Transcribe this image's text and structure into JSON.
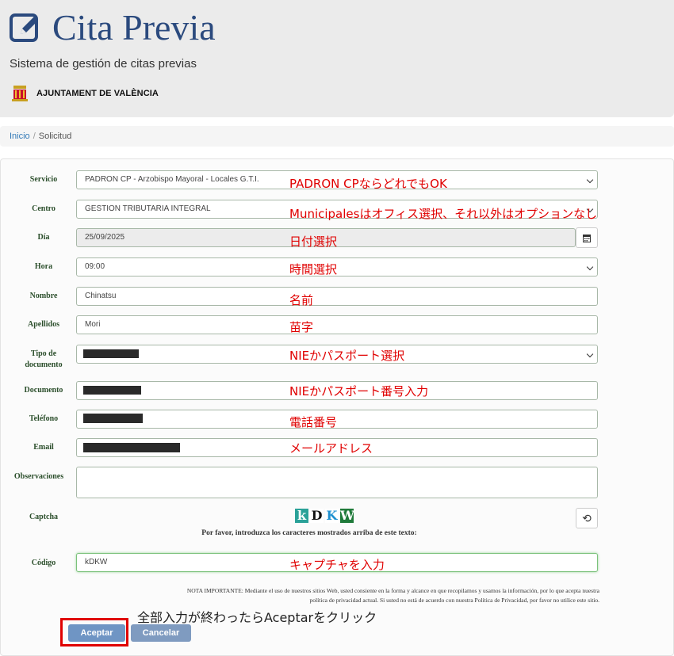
{
  "header": {
    "title": "Cita Previa",
    "subtitle": "Sistema de gestión de citas previas",
    "org_name": "AJUNTAMENT DE VALÈNCIA"
  },
  "breadcrumb": {
    "home": "Inicio",
    "separator": "/",
    "current": "Solicitud"
  },
  "form": {
    "servicio": {
      "label": "Servicio",
      "value": "PADRON CP - Arzobispo Mayoral - Locales G.T.I."
    },
    "centro": {
      "label": "Centro",
      "value": "GESTION TRIBUTARIA INTEGRAL"
    },
    "dia": {
      "label": "Día",
      "value": "25/09/2025"
    },
    "hora": {
      "label": "Hora",
      "value": "09:00"
    },
    "nombre": {
      "label": "Nombre",
      "value": "Chinatsu"
    },
    "apellidos": {
      "label": "Apellidos",
      "value": "Mori"
    },
    "tipo_documento": {
      "label_line1": "Tipo de",
      "label_line2": "documento"
    },
    "documento": {
      "label": "Documento"
    },
    "telefono": {
      "label": "Teléfono"
    },
    "email": {
      "label": "Email"
    },
    "observaciones": {
      "label": "Observaciones",
      "value": ""
    },
    "captcha": {
      "label": "Captcha",
      "chars": [
        "k",
        "D",
        "K",
        "W"
      ],
      "help": "Por favor, introduzca los caracteres mostrados arriba de este texto:",
      "refresh_icon": "⟲"
    },
    "codigo": {
      "label": "Código",
      "value": "kDKW"
    }
  },
  "legal_note": "NOTA IMPORTANTE: Mediante el uso de nuestros sitios Web, usted consiente en la forma y alcance en que recopilamos y usamos la información, por lo que acepta nuestra política de privacidad actual. Si usted no está de acuerdo con nuestra Política de Privacidad, por favor no utilice este sitio.",
  "buttons": {
    "accept": "Aceptar",
    "cancel": "Cancelar"
  },
  "annotations": {
    "servicio": "PADRON CPならどれでもOK",
    "centro": "Municipalesはオフィス選択、それ以外はオプションなし",
    "dia": "日付選択",
    "hora": "時間選択",
    "nombre": "名前",
    "apellidos": "苗字",
    "tipo_documento": "NIEかパスポート選択",
    "documento": "NIEかパスポート番号入力",
    "telefono": "電話番号",
    "email": "メールアドレス",
    "codigo": "キャプチャを入力",
    "submit": "全部入力が終わったらAceptarをクリック"
  },
  "colors": {
    "title": "#2b4a7e",
    "annotation_red": "#e00000",
    "label_green": "#2c4f2c",
    "button_blue": "#6f95c4"
  }
}
